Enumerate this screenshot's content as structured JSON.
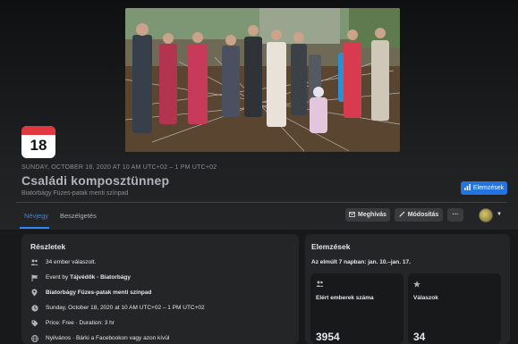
{
  "event": {
    "day": "18",
    "date_line": "SUNDAY, OCTOBER 18, 2020 AT 10 AM UTC+02 – 1 PM UTC+02",
    "title": "Családi komposztünnep",
    "location": "Biatorbágy Füzes-patak menti színpad"
  },
  "buttons": {
    "insights": "Elemzések",
    "invite": "Meghívás",
    "edit": "Módosítás",
    "more": "···"
  },
  "tabs": [
    {
      "label": "Névjegy",
      "active": true
    },
    {
      "label": "Beszélgetés",
      "active": false
    }
  ],
  "details": {
    "title": "Részletek",
    "rows": [
      {
        "icon": "people-icon",
        "text": "34 ember válaszolt."
      },
      {
        "icon": "flag-icon",
        "prefix": "Event by ",
        "bold": "Tájvédők - Biatorbágy"
      },
      {
        "icon": "pin-icon",
        "bold": "Biatorbágy Füzes-patak menti színpad"
      },
      {
        "icon": "clock-icon",
        "text": "Sunday, October 18, 2020 at 10 AM UTC+02 – 1 PM UTC+02"
      },
      {
        "icon": "tag-icon",
        "text": "Price: Free · Duration: 3 hr"
      },
      {
        "icon": "globe-icon",
        "text": "Nyilvános · Bárki a Facebookon vagy azon kívül"
      }
    ]
  },
  "insights": {
    "title": "Elemzések",
    "period": "Az elmúlt 7 napban: jan. 10.–jan. 17.",
    "stats": [
      {
        "icon": "people-icon",
        "label": "Elért emberek száma",
        "value": "3954"
      },
      {
        "icon": "star-icon",
        "label": "Válaszok",
        "value": "34"
      }
    ]
  },
  "colors": {
    "accent": "#2374e1",
    "tab_active": "#2d88ff",
    "calendar_red": "#e0383e"
  }
}
